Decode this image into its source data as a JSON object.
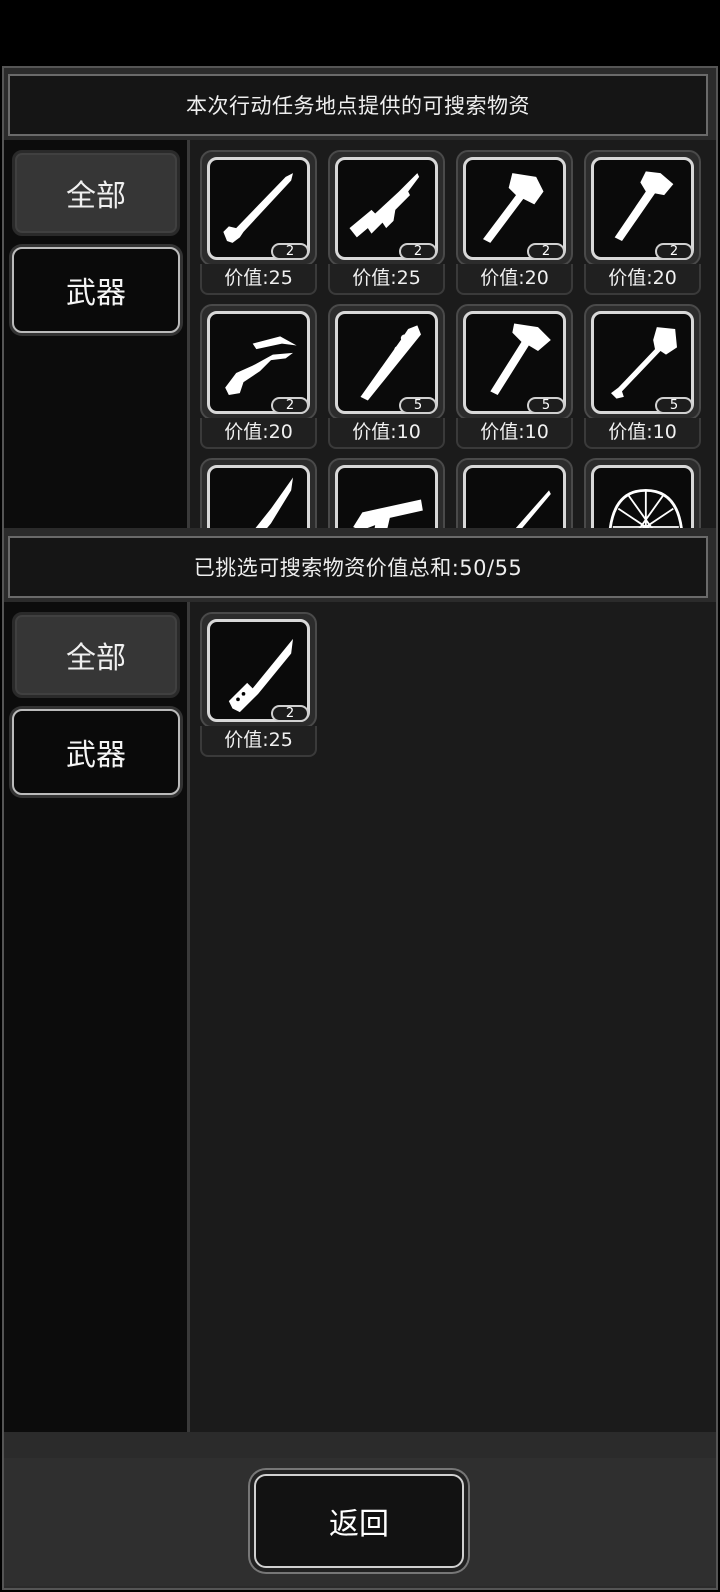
{
  "top_section": {
    "title": "本次行动任务地点提供的可搜索物资",
    "tabs": [
      {
        "label": "全部",
        "active": true
      },
      {
        "label": "武器",
        "active": false
      }
    ],
    "items": [
      {
        "icon": "shotgun-icon",
        "count": "2",
        "price": "价值:25"
      },
      {
        "icon": "assault-rifle-icon",
        "count": "2",
        "price": "价值:25"
      },
      {
        "icon": "axe-icon",
        "count": "2",
        "price": "价值:20"
      },
      {
        "icon": "hatchet-icon",
        "count": "2",
        "price": "价值:20"
      },
      {
        "icon": "crossbow-icon",
        "count": "2",
        "price": "价值:20"
      },
      {
        "icon": "spiked-bat-icon",
        "count": "5",
        "price": "价值:10"
      },
      {
        "icon": "fire-axe-icon",
        "count": "5",
        "price": "价值:10"
      },
      {
        "icon": "shovel-icon",
        "count": "5",
        "price": "价值:10"
      },
      {
        "icon": "machete-icon",
        "count": "",
        "price": ""
      },
      {
        "icon": "pistol-icon",
        "count": "",
        "price": ""
      },
      {
        "icon": "sword-icon",
        "count": "",
        "price": ""
      },
      {
        "icon": "helmet-icon",
        "count": "",
        "price": ""
      }
    ]
  },
  "bottom_section": {
    "title": "已挑选可搜索物资价值总和:50/55",
    "tabs": [
      {
        "label": "全部",
        "active": true
      },
      {
        "label": "武器",
        "active": false
      }
    ],
    "items": [
      {
        "icon": "knife-icon",
        "count": "2",
        "price": "价值:25"
      }
    ]
  },
  "footer": {
    "back_label": "返回"
  },
  "colors": {
    "background": "#000000",
    "panel": "#2b2b2b",
    "grid": "#1b1b1b",
    "sidebar": "#0c0c0c",
    "accent": "#d8d8d8"
  }
}
